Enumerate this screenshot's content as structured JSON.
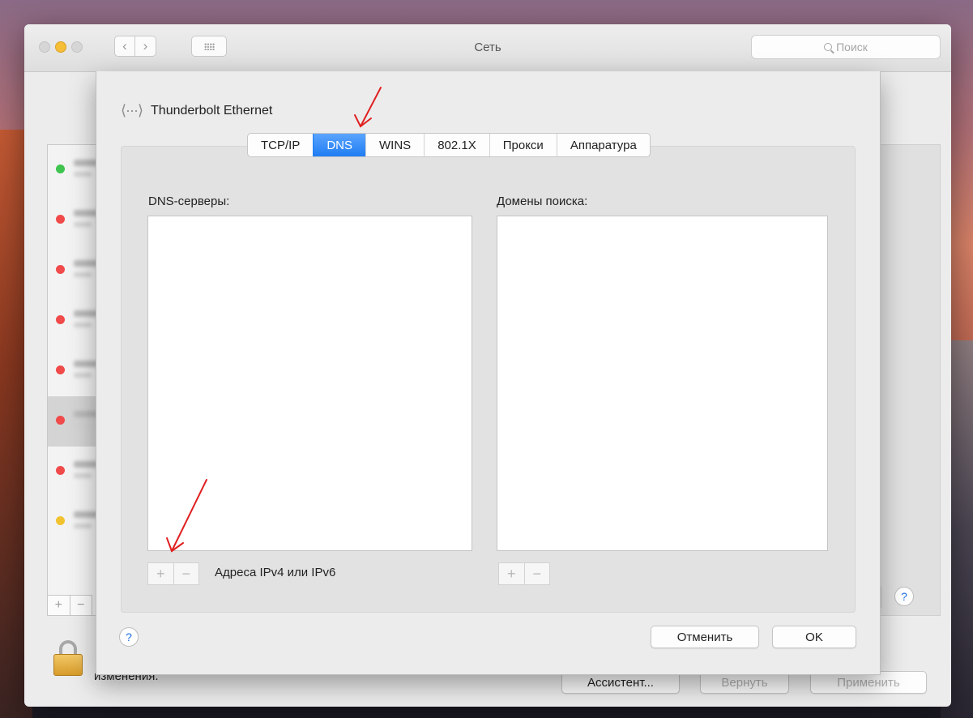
{
  "window": {
    "title": "Сеть"
  },
  "toolbar": {
    "back_icon": "‹",
    "forward_icon": "›",
    "search_placeholder": "Поиск"
  },
  "services": {
    "items": [
      {
        "status": "#3fc44f"
      },
      {
        "status": "#f04a4a"
      },
      {
        "status": "#f04a4a"
      },
      {
        "status": "#f04a4a"
      },
      {
        "status": "#f04a4a"
      },
      {
        "status": "#f04a4a"
      },
      {
        "status": "#f04a4a"
      },
      {
        "status": "#f2c230"
      }
    ],
    "add_label": "+",
    "remove_label": "−"
  },
  "background": {
    "help_label": "?",
    "lock_text": "изменения.",
    "assistant_label": "Ассистент...",
    "revert_label": "Вернуть",
    "apply_label": "Применить"
  },
  "sheet": {
    "interface_icon": "⟨···⟩",
    "interface_name": "Thunderbolt Ethernet",
    "tabs": [
      {
        "label": "TCP/IP"
      },
      {
        "label": "DNS"
      },
      {
        "label": "WINS"
      },
      {
        "label": "802.1X"
      },
      {
        "label": "Прокси"
      },
      {
        "label": "Аппаратура"
      }
    ],
    "active_tab": "DNS",
    "dns_servers_label": "DNS-серверы:",
    "search_domains_label": "Домены поиска:",
    "add_label": "+",
    "remove_label": "−",
    "address_hint": "Адреса IPv4 или IPv6",
    "help_label": "?",
    "cancel_label": "Отменить",
    "ok_label": "OK"
  },
  "colors": {
    "accent": "#1f7df2",
    "annotation_arrow": "#e02020"
  }
}
